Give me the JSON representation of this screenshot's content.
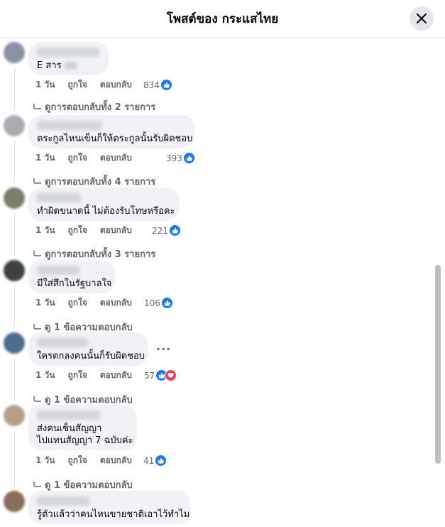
{
  "header": {
    "title": "โพสต์ของ กระแสไทย"
  },
  "actions": {
    "time": "1 วัน",
    "like": "ถูกใจ",
    "reply": "ตอบกลับ"
  },
  "comments": [
    {
      "text_lines": [
        "E สาร"
      ],
      "reactions": "834",
      "view_replies": "ดูการตอบกลับทั้ง 2 รายการ"
    },
    {
      "text_lines": [
        "ตระกูลไหนเข็นก็ให้ตระกูลนั้นรับผิดชอบ"
      ],
      "reactions": "393",
      "view_replies": "ดูการตอบกลับทั้ง 4 รายการ"
    },
    {
      "text_lines": [
        "ทำผิดขนาดนี้ ไม่ต้องรับโทษหรือคะ"
      ],
      "reactions": "221",
      "view_replies": "ดูการตอบกลับทั้ง 3 รายการ"
    },
    {
      "text_lines": [
        "มีใส่สึกในรัฐบาลใจ"
      ],
      "reactions": "106",
      "view_replies": "ดู 1 ข้อความตอบกลับ"
    },
    {
      "text_lines": [
        "ใครตกลงคนนั้นก็รับผิดชอบ"
      ],
      "reactions": "57",
      "view_replies": "ดู 1 ข้อความตอบกลับ",
      "more": "···"
    },
    {
      "text_lines": [
        "ส่งคนเซ็นสัญญา",
        "ไปแทนสัญญา 7 ฉบับค่ะ"
      ],
      "reactions": "41",
      "view_replies": "ดู 1 ข้อความตอบกลับ"
    },
    {
      "text_lines": [
        "รู้ตัวแล้วว่าคนไหนขายชาติเอาไว้ทำไม"
      ]
    }
  ],
  "icons": {
    "close": "close-icon",
    "like": "like-icon",
    "love": "love-icon",
    "reply_arrow": "reply-arrow-icon"
  },
  "colors": {
    "like_blue": "#1877f2",
    "love_red": "#f33e58",
    "bubble_bg": "#f0f2f5",
    "secondary_text": "#65676b"
  }
}
